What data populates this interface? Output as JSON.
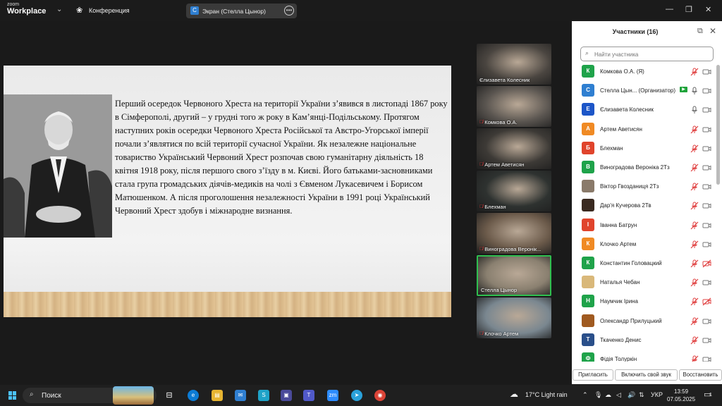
{
  "app": {
    "logo_line1": "zoom",
    "logo_line2": "Workplace",
    "meeting_label": "Конференция",
    "share_badge": "C",
    "share_title": "Экран (Стелла Цынор)"
  },
  "slide": {
    "text": "Перший осередок Червоного Хреста на території України з’явився в листопаді 1867 року в Сімферополі, другий – у грудні того ж року в Кам’янці-Подільському. Протягом наступних років осередки Червоного Хреста Російської та Австро-Угорської імперії почали з’являтися по всій території сучасної України. Як незалежне національне товариство Український Червоний Хрест розпочав свою гуманітарну діяльність 18 квітня 1918 року, після першого свого з’їзду в м. Києві. Його батьками-засновниками стала група громадських діячів-медиків на чолі з Євменом Лукасевичем і Борисом Матюшенком. А після проголошення незалежності України в 1991 році Український Червоний Хрест здобув і  міжнародне визнання."
  },
  "gallery": [
    {
      "name": "Єлизавета Колесник",
      "muted": false,
      "bg": "#4a4540"
    },
    {
      "name": "Комкова О.А.",
      "muted": true,
      "bg": "#5a5550"
    },
    {
      "name": "Артем Аветисян",
      "muted": true,
      "bg": "#3d3a36"
    },
    {
      "name": "Блехман",
      "muted": true,
      "bg": "#2e3230"
    },
    {
      "name": "Виноградова Веронік...",
      "muted": true,
      "bg": "#6b5a4a"
    },
    {
      "name": "Стелла Цынор",
      "muted": false,
      "bg": "#8a8070"
    },
    {
      "name": "Клочко Артем",
      "muted": true,
      "bg": "#7a8790"
    }
  ],
  "panel": {
    "title": "Участники (16)",
    "search_placeholder": "Найти участника",
    "participants": [
      {
        "initial": "К",
        "color": "#1fa34a",
        "name": "Комкова О.А. (Я)",
        "mic": "muted",
        "cam": "off",
        "rec": false
      },
      {
        "initial": "С",
        "color": "#2f7fd1",
        "name": "Стелла Цын... (Организатор)",
        "mic": "on",
        "cam": "off",
        "rec": true
      },
      {
        "initial": "Е",
        "color": "#1d56c8",
        "name": "Єлизавета Колесник",
        "mic": "on",
        "cam": "off",
        "rec": false
      },
      {
        "initial": "А",
        "color": "#f08a24",
        "name": "Артем Аветисян",
        "mic": "muted",
        "cam": "off",
        "rec": false
      },
      {
        "initial": "Б",
        "color": "#e0442c",
        "name": "Блехман",
        "mic": "muted",
        "cam": "off",
        "rec": false
      },
      {
        "initial": "В",
        "color": "#1fa34a",
        "name": "Виноградова Вероніка 2Тз",
        "mic": "muted",
        "cam": "off",
        "rec": false
      },
      {
        "initial": "",
        "color": "#8a7a6a",
        "name": "Віктор Гвозданиця 2Тз",
        "mic": "muted",
        "cam": "off",
        "rec": false
      },
      {
        "initial": "",
        "color": "#3a2a20",
        "name": "Дар'я Кучерова 2Тв",
        "mic": "muted",
        "cam": "off",
        "rec": false
      },
      {
        "initial": "І",
        "color": "#e0442c",
        "name": "Іванна Батрун",
        "mic": "muted",
        "cam": "off",
        "rec": false
      },
      {
        "initial": "К",
        "color": "#f08a24",
        "name": "Клочко Артем",
        "mic": "muted",
        "cam": "off",
        "rec": false
      },
      {
        "initial": "К",
        "color": "#1fa34a",
        "name": "Константин Головацкий",
        "mic": "muted",
        "cam": "crossed",
        "rec": false
      },
      {
        "initial": "",
        "color": "#d9b87a",
        "name": "Наталья Чебан",
        "mic": "muted",
        "cam": "off",
        "rec": false
      },
      {
        "initial": "Н",
        "color": "#1fa34a",
        "name": "Наумчик Ірина",
        "mic": "muted",
        "cam": "crossed",
        "rec": false
      },
      {
        "initial": "",
        "color": "#a05a20",
        "name": "Олександр Прилуцький",
        "mic": "muted",
        "cam": "off",
        "rec": false
      },
      {
        "initial": "Т",
        "color": "#2a4f8a",
        "name": "Ткаченко Денис",
        "mic": "muted",
        "cam": "off",
        "rec": false
      },
      {
        "initial": "Ф",
        "color": "#1fa34a",
        "name": "Фідія Толуркін",
        "mic": "muted",
        "cam": "off",
        "rec": false
      }
    ],
    "buttons": {
      "invite": "Пригласить",
      "unmute_self": "Включить свой звук",
      "restore": "Восстановить"
    }
  },
  "taskbar": {
    "search_label": "Поиск",
    "weather": "17°C  Light rain",
    "lang": "УКР",
    "time": "13:59",
    "date": "07.05.2025",
    "notif_count": "1"
  }
}
